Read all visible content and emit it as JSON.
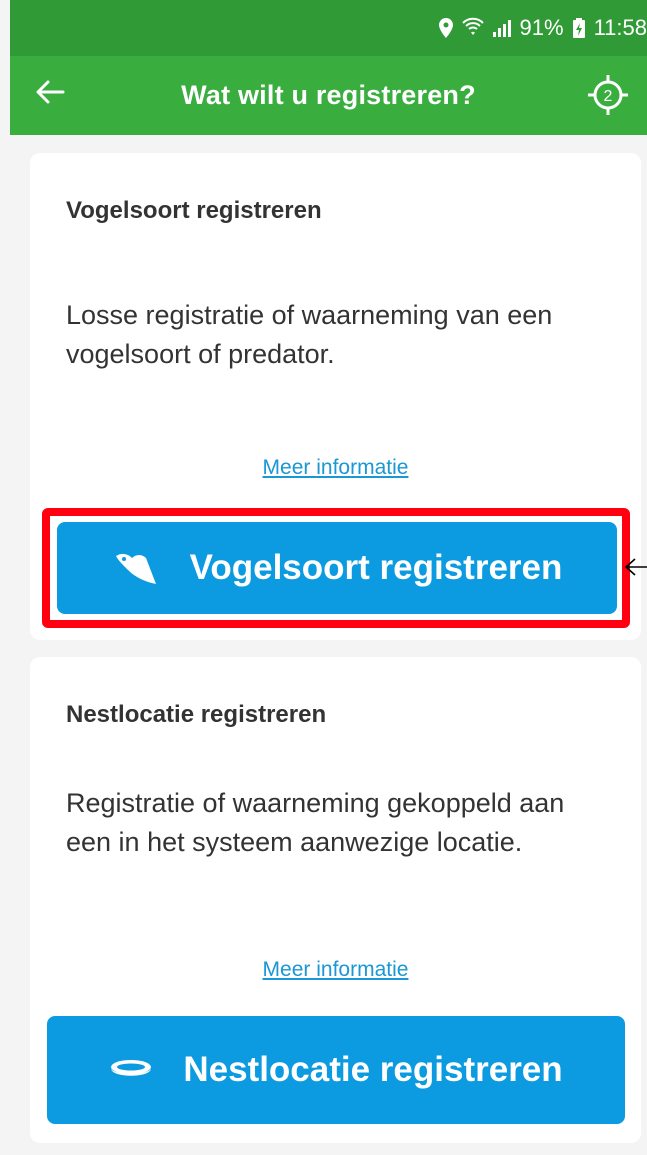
{
  "status_bar": {
    "wifi_signal_text": "",
    "battery": "91%",
    "time": "11:58"
  },
  "app_bar": {
    "title": "Wat wilt u registreren?",
    "gps_badge": "2"
  },
  "cards": [
    {
      "title": "Vogelsoort registreren",
      "description": "Losse registratie of waarneming van een vogelsoort of predator.",
      "link": "Meer informatie",
      "button_label": "Vogelsoort registreren",
      "button_icon": "bird-icon"
    },
    {
      "title": "Nestlocatie registreren",
      "description": "Registratie of waarneming gekoppeld aan een in het systeem aanwezige locatie.",
      "link": "Meer informatie",
      "button_label": "Nestlocatie registreren",
      "button_icon": "nest-icon"
    }
  ],
  "colors": {
    "status_bar": "#2f9a36",
    "app_bar": "#3aad3f",
    "button": "#0c9be0",
    "link": "#1a97d5",
    "highlight": "#ff0010"
  }
}
